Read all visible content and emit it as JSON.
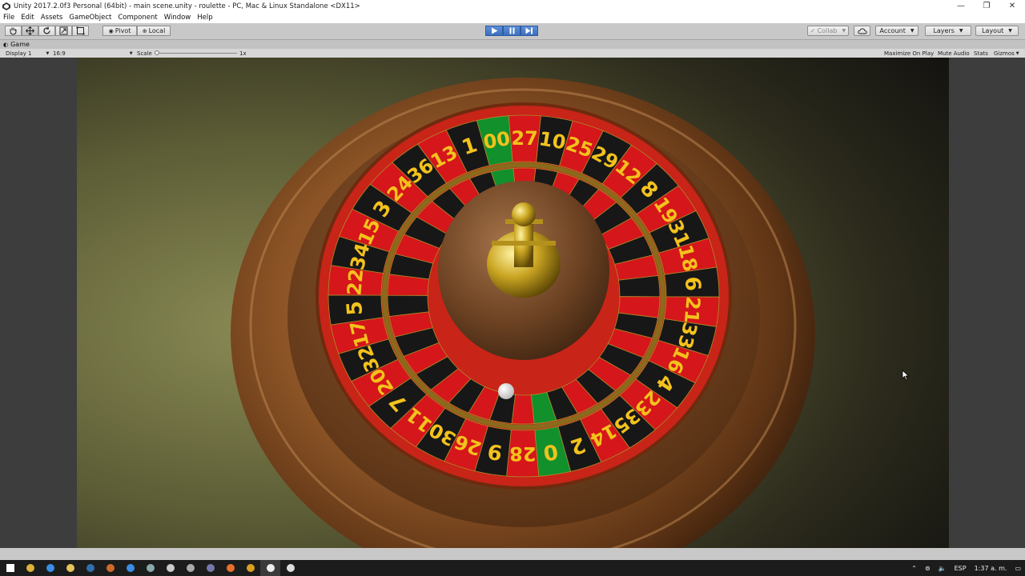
{
  "window": {
    "title": "Unity 2017.2.0f3 Personal (64bit) - main scene.unity - roulette - PC, Mac & Linux Standalone <DX11>",
    "minimize_glyph": "—",
    "restore_glyph": "❐",
    "close_glyph": "✕"
  },
  "menu": [
    "File",
    "Edit",
    "Assets",
    "GameObject",
    "Component",
    "Window",
    "Help"
  ],
  "toolbar": {
    "pivot_label": "Pivot",
    "local_label": "Local",
    "collab_label": "Collab",
    "account_label": "Account",
    "layers_label": "Layers",
    "layout_label": "Layout"
  },
  "game_view": {
    "tab_label": "Game",
    "display_label": "Display 1",
    "aspect_label": "16:9",
    "scale_label": "Scale",
    "scale_value": "1x",
    "maximize_label": "Maximize On Play",
    "mute_label": "Mute Audio",
    "stats_label": "Stats",
    "gizmos_label": "Gizmos"
  },
  "roulette": {
    "outer_numbers": [
      "00",
      "27",
      "10",
      "25",
      "29",
      "12",
      "8",
      "19",
      "31",
      "18",
      "6",
      "21",
      "33",
      "16",
      "4",
      "23",
      "35",
      "14",
      "2",
      "0",
      "28",
      "9",
      "26",
      "30",
      "11",
      "7",
      "20",
      "32",
      "17",
      "5",
      "22",
      "34",
      "15",
      "3",
      "24",
      "36",
      "13",
      "1"
    ],
    "green_numbers": [
      "0",
      "00"
    ]
  },
  "tray": {
    "language": "ESP",
    "clock": "1:37 a. m."
  },
  "colors": {
    "pocket_red": "#d5161a",
    "pocket_black": "#171717",
    "pocket_green": "#12902c",
    "number_text": "#f3c21c",
    "toolbar_bg": "#c8c8c8",
    "play_blue": "#3b6fbe"
  },
  "icons": {
    "taskbar": [
      "windows-start-icon",
      "file-explorer-icon",
      "chrome-icon",
      "folder-icon",
      "steam-icon",
      "app-icon",
      "chrome-icon",
      "app-icon",
      "app-icon",
      "app-icon",
      "app-icon",
      "firefox-icon",
      "app-icon",
      "unity-icon",
      "clock-icon"
    ]
  }
}
